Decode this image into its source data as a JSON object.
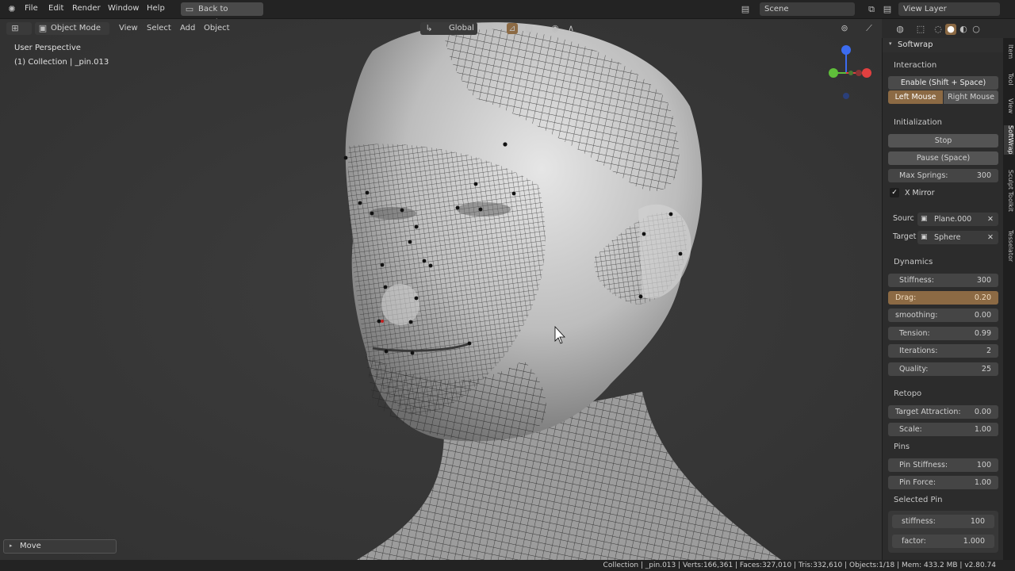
{
  "topbar": {
    "menu": [
      "File",
      "Edit",
      "Render",
      "Window",
      "Help"
    ],
    "back_button": "Back to Previous",
    "scene_label": "Scene",
    "view_layer_label": "View Layer"
  },
  "viewport_header": {
    "mode": "Object Mode",
    "menus": [
      "View",
      "Select",
      "Add",
      "Object"
    ],
    "orientation": "Global"
  },
  "viewport": {
    "perspective_label": "User Perspective",
    "collection_label": "(1) Collection | _pin.013",
    "operator_panel": "Move"
  },
  "sidebar": {
    "panel_title": "Softwrap",
    "tabs": [
      "Item",
      "Tool",
      "View",
      "SoftWrap",
      "Sculpt Toolkit",
      "Tesselator"
    ],
    "interaction": {
      "label": "Interaction",
      "enable_button": "Enable (Shift + Space)",
      "left_mouse": "Left Mouse",
      "right_mouse": "Right Mouse"
    },
    "initialization": {
      "label": "Initialization",
      "stop_button": "Stop",
      "pause_button": "Pause (Space)",
      "max_springs_label": "Max Springs:",
      "max_springs_value": "300",
      "x_mirror_label": "X Mirror"
    },
    "source_label": "Sourc",
    "source_value": "Plane.000",
    "target_label": "Target",
    "target_value": "Sphere",
    "dynamics": {
      "label": "Dynamics",
      "fields": [
        {
          "label": "Stiffness:",
          "value": "300"
        },
        {
          "label": "Drag:",
          "value": "0.20"
        },
        {
          "label": "smoothing:",
          "value": "0.00"
        },
        {
          "label": "Tension:",
          "value": "0.99"
        },
        {
          "label": "Iterations:",
          "value": "2"
        },
        {
          "label": "Quality:",
          "value": "25"
        }
      ]
    },
    "retopo": {
      "label": "Retopo",
      "fields": [
        {
          "label": "Target Attraction:",
          "value": "0.00"
        },
        {
          "label": "Scale:",
          "value": "1.00"
        }
      ]
    },
    "pins": {
      "label": "Pins",
      "fields": [
        {
          "label": "Pin Stiffness:",
          "value": "100"
        },
        {
          "label": "Pin Force:",
          "value": "1.00"
        }
      ]
    },
    "selected_pin": {
      "label": "Selected Pin",
      "fields": [
        {
          "label": "stiffness:",
          "value": "100"
        },
        {
          "label": "factor:",
          "value": "1.000"
        }
      ]
    }
  },
  "statusbar": {
    "text": "Collection | _pin.013 | Verts:166,361 | Faces:327,010 | Tris:332,610 | Objects:1/18 | Mem: 433.2 MB | v2.80.74"
  },
  "colors": {
    "accent": "#8c6a44",
    "axis_x": "#e24040",
    "axis_y": "#5fbf3a",
    "axis_z": "#3c6cf0"
  }
}
